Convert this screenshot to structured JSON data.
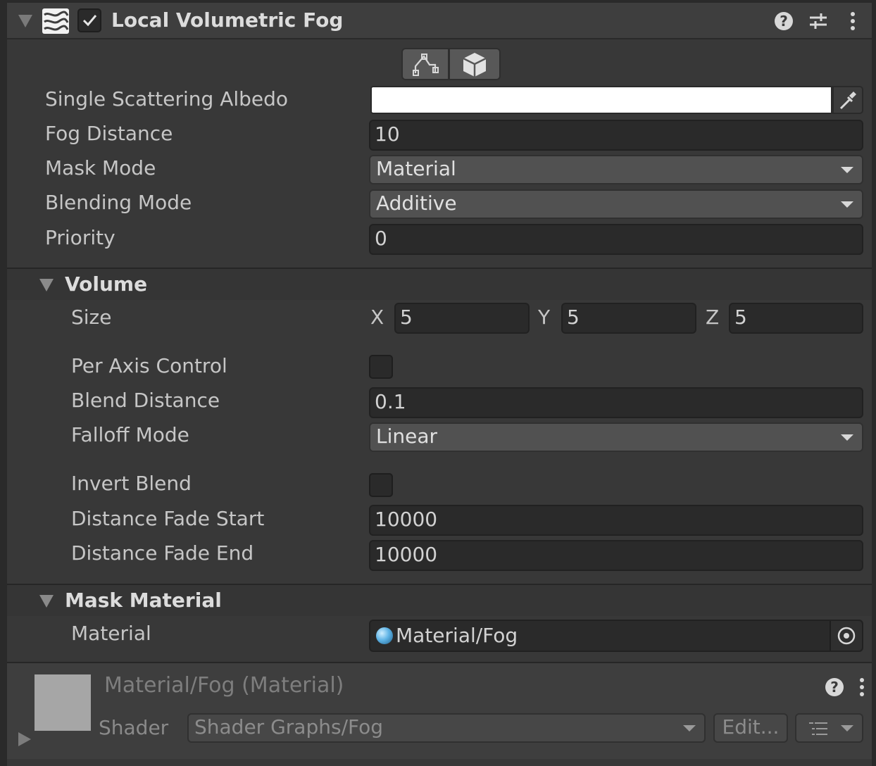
{
  "header": {
    "title": "Local Volumetric Fog",
    "enabled": true
  },
  "toolbar": {
    "icons": [
      "edit-shape-icon",
      "cube-icon"
    ]
  },
  "fields": {
    "single_scattering_albedo": {
      "label": "Single Scattering Albedo",
      "color": "#ffffff"
    },
    "fog_distance": {
      "label": "Fog Distance",
      "value": "10"
    },
    "mask_mode": {
      "label": "Mask Mode",
      "value": "Material"
    },
    "blending_mode": {
      "label": "Blending Mode",
      "value": "Additive"
    },
    "priority": {
      "label": "Priority",
      "value": "0"
    }
  },
  "volume": {
    "title": "Volume",
    "size": {
      "label": "Size",
      "x_label": "X",
      "x": "5",
      "y_label": "Y",
      "y": "5",
      "z_label": "Z",
      "z": "5"
    },
    "per_axis_control": {
      "label": "Per Axis Control",
      "checked": false
    },
    "blend_distance": {
      "label": "Blend Distance",
      "value": "0.1"
    },
    "falloff_mode": {
      "label": "Falloff Mode",
      "value": "Linear"
    },
    "invert_blend": {
      "label": "Invert Blend",
      "checked": false
    },
    "distance_fade_start": {
      "label": "Distance Fade Start",
      "value": "10000"
    },
    "distance_fade_end": {
      "label": "Distance Fade End",
      "value": "10000"
    }
  },
  "mask_material": {
    "title": "Mask Material",
    "material": {
      "label": "Material",
      "value": "Material/Fog"
    }
  },
  "material_footer": {
    "title": "Material/Fog (Material)",
    "shader_label": "Shader",
    "shader_value": "Shader Graphs/Fog",
    "edit_label": "Edit..."
  },
  "colors": {
    "panel_bg": "#383838",
    "field_bg": "#2a2a2a",
    "dropdown_bg": "#515151",
    "albedo": "#ffffff"
  }
}
